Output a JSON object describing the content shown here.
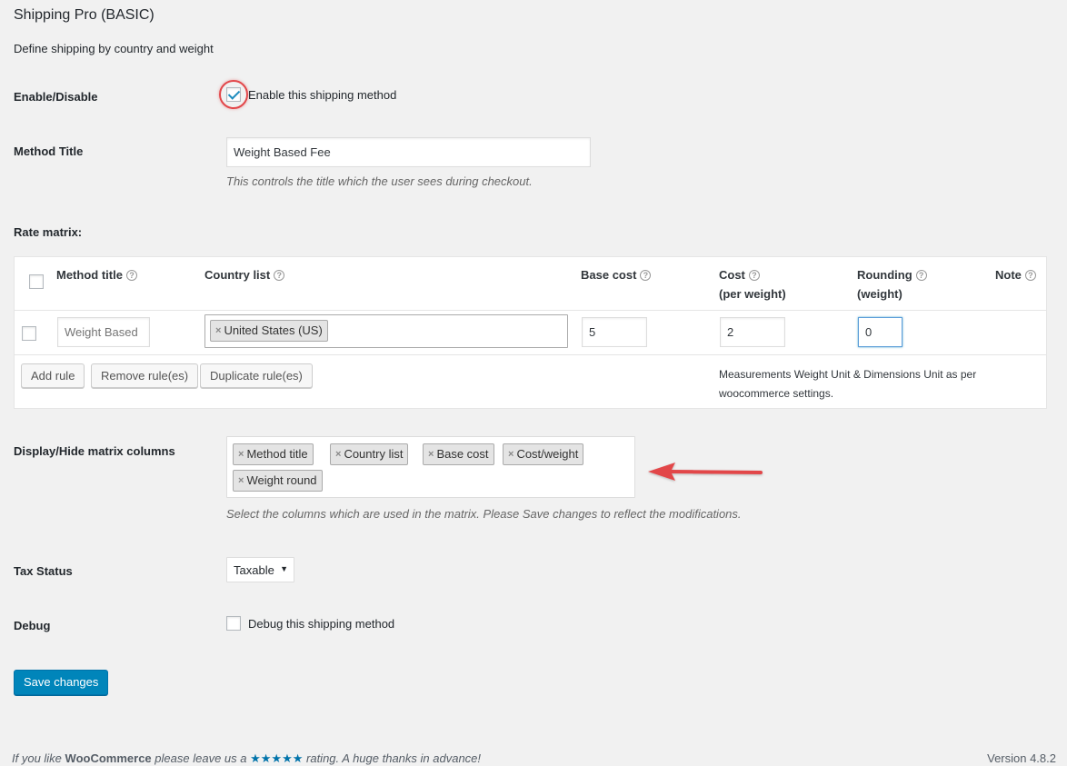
{
  "header": {
    "title": "Shipping Pro (BASIC)",
    "description": "Define shipping by country and weight"
  },
  "enable": {
    "label": "Enable/Disable",
    "checkbox_label": "Enable this shipping method",
    "checked": true
  },
  "method_title": {
    "label": "Method Title",
    "value": "Weight Based Fee",
    "description": "This controls the title which the user sees during checkout."
  },
  "rate_matrix": {
    "label": "Rate matrix:",
    "headers": {
      "method_title": "Method title",
      "country_list": "Country list",
      "base_cost": "Base cost",
      "cost_line1": "Cost",
      "cost_line2": "(per weight)",
      "rounding_line1": "Rounding",
      "rounding_line2": "(weight)",
      "note": "Note"
    },
    "help_glyph": "?",
    "row": {
      "method_title_placeholder": "Weight Based",
      "country_token": "United States (US)",
      "base_cost": "5",
      "cost_per_weight": "2",
      "rounding": "0"
    },
    "buttons": {
      "add": "Add rule",
      "remove": "Remove rule(es)",
      "duplicate": "Duplicate rule(es)"
    },
    "note_line1": "Measurements Weight Unit & Dimensions Unit as per",
    "note_line2": "woocommerce settings."
  },
  "display_columns": {
    "label": "Display/Hide matrix columns",
    "tokens": [
      "Method title",
      "Country list",
      "Base cost",
      "Cost/weight",
      "Weight round"
    ],
    "remove_glyph": "×",
    "description": "Select the columns which are used in the matrix. Please Save changes to reflect the modifications."
  },
  "tax_status": {
    "label": "Tax Status",
    "value": "Taxable",
    "arrow": "▼"
  },
  "debug": {
    "label": "Debug",
    "checkbox_label": "Debug this shipping method",
    "checked": false
  },
  "save_button": "Save changes",
  "footer": {
    "left_prefix": "If you like",
    "brand": "WooCommerce",
    "left_middle": "please leave us a",
    "stars": "★★★★★",
    "left_suffix": "rating. A huge thanks in advance!",
    "version": "Version 4.8.2"
  },
  "colors": {
    "accent": "#0085ba",
    "highlight": "#e2474a",
    "background": "#f1f1f1"
  }
}
